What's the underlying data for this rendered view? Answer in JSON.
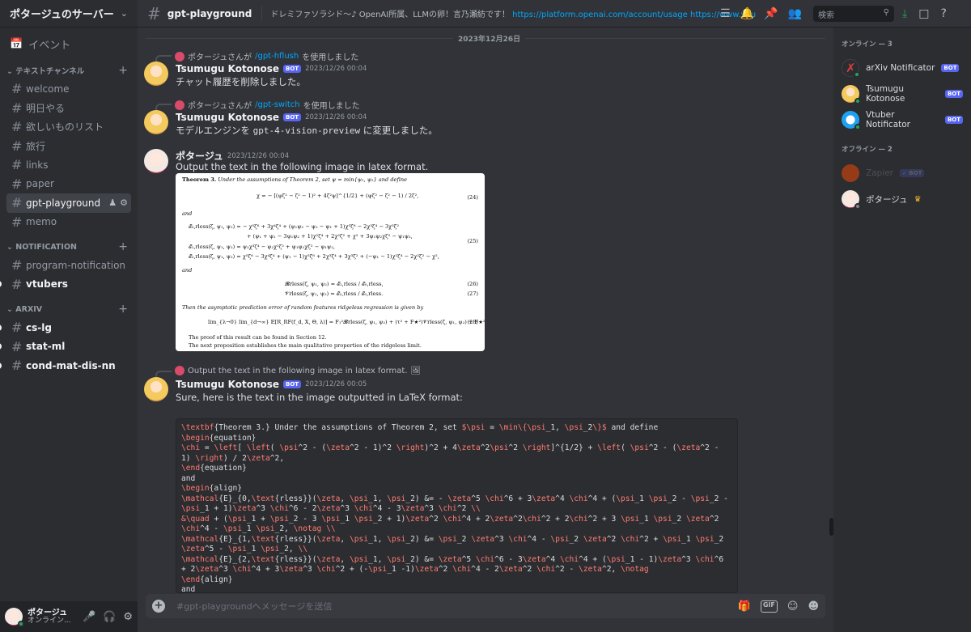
{
  "server": {
    "name": "ポタージュのサーバー"
  },
  "sidebar": {
    "event_label": "イベント",
    "categories": [
      {
        "label": "テキストチャンネル",
        "channels": [
          {
            "label": "welcome"
          },
          {
            "label": "明日やる"
          },
          {
            "label": "欲しいものリスト"
          },
          {
            "label": "旅行"
          },
          {
            "label": "links"
          },
          {
            "label": "paper"
          },
          {
            "label": "gpt-playground"
          },
          {
            "label": "memo"
          }
        ]
      },
      {
        "label": "NOTIFICATION",
        "channels": [
          {
            "label": "program-notification"
          },
          {
            "label": "vtubers"
          }
        ]
      },
      {
        "label": "ARXIV",
        "channels": [
          {
            "label": "cs-lg"
          },
          {
            "label": "stat-ml"
          },
          {
            "label": "cond-mat-dis-nn"
          }
        ]
      }
    ]
  },
  "user_panel": {
    "name": "ポタージュ",
    "status": "オンライン..."
  },
  "topbar": {
    "channel": "gpt-playground",
    "topic_text": "ドレミファソラシド〜♪ OpenAI所属、LLMの卵！言乃瀬紡です！",
    "topic_links": "https://platform.openai.com/account/usage https://www.youtube.com...",
    "search_placeholder": "検索"
  },
  "chat": {
    "date": "2023年12月26日",
    "messages": [
      {
        "ref_user": "ポタージュさんが",
        "ref_cmd": "/gpt-hflush",
        "ref_suffix": "を使用しました",
        "author": "Tsumugu Kotonose",
        "bot": "BOT",
        "timestamp": "2023/12/26 00:04",
        "text": "チャット履歴を削除しました。"
      },
      {
        "ref_user": "ポタージュさんが",
        "ref_cmd": "/gpt-switch",
        "ref_suffix": "を使用しました",
        "author": "Tsumugu Kotonose",
        "bot": "BOT",
        "timestamp": "2023/12/26 00:04",
        "text_pre": "モデルエンジンを ",
        "text_code": "gpt-4-vision-preview",
        "text_post": " に変更しました。"
      },
      {
        "author": "ポタージュ",
        "timestamp": "2023/12/26 00:04",
        "text": "Output the text in the following image in latex format.",
        "attachment": {
          "l1_b": "Theorem 3.",
          "l1": "Under the assumptions of Theorem 2, set ψ = min{ψ₁, ψ₂} and define",
          "eq24": "χ = − [(ψζ² − ζ² − 1)² + 4ζ²ψ]^{1/2} + (ψζ² − ζ² − 1) / 2ζ²,",
          "n24": "(24)",
          "and1": "and",
          "eq25a": "𝓔₀,rless(ζ, ψ₁, ψ₂) = − χ⁵ζ⁶ + 3χ⁴ζ⁴ + (ψ₁ψ₂ − ψ₂ − ψ₁ + 1)χ³ζ⁶ − 2χ³ζ⁴ − 3χ³ζ²",
          "eq25b": "+ (ψ₁ + ψ₂ − 3ψ₁ψ₂ + 1)χ²ζ⁴ + 2χ²ζ² + χ² + 3ψ₁ψ₂χζ² − ψ₁ψ₂,",
          "n25": "(25)",
          "eq25c": "𝓔₁,rless(ζ, ψ₁, ψ₂) = ψ₂χ³ζ⁴ − ψ₂χ²ζ² + ψ₁ψ₂χζ² − ψ₁ψ₂,",
          "eq25d": "𝓔₂,rless(ζ, ψ₁, ψ₂) = χ⁵ζ⁶ − 3χ⁴ζ⁴ + (ψ₁ − 1)χ³ζ⁶ + 2χ³ζ⁴ + 3χ³ζ² + (−ψ₁ − 1)χ²ζ⁴ − 2χ²ζ² − χ²,",
          "and2": "and",
          "eq26": "𝓑rless(ζ, ψ₁, ψ₂) = 𝓔₁,rless / 𝓔₀,rless,",
          "n26": "(26)",
          "eq27": "𝓥rless(ζ, ψ₁, ψ₂) = 𝓔₂,rless / 𝓔₀,rless.",
          "n27": "(27)",
          "then": "Then the asymptotic prediction error of random features ridgeless regression is given by",
          "eq28": "lim_{λ→0} lim_{d→∞} 𝔼[R_RF(f_d, X, Θ, λ)] = F₁²𝓑rless(ζ, ψ₁, ψ₂) + (τ² + F★²)𝓥rless(ζ, ψ₁, ψ₂) + F★².",
          "n28": "(28)",
          "proof": "The proof of this result can be found in Section 12.",
          "next": "The next proposition establishes the main qualitative properties of the ridgeless limit."
        }
      },
      {
        "ref_user": "",
        "ref_cmd": "",
        "ref_suffix": "Output the text in the following image in latex format.",
        "author": "Tsumugu Kotonose",
        "bot": "BOT",
        "timestamp": "2023/12/26 00:05",
        "text": "Sure, here is the text in the image outputted in LaTeX format:",
        "code_lines": [
          [
            "\\textbf",
            "{Theorem 3.} Under the assumptions of Theorem 2, set ",
            "$\\psi",
            " = ",
            "\\min",
            "\\{",
            "\\psi",
            "_1, ",
            "\\psi",
            "_2",
            "\\}",
            "$",
            " and define"
          ],
          [
            "\\begin",
            "{equation}"
          ],
          [
            "\\chi",
            " = ",
            "\\left",
            "[ ",
            "\\left",
            "( ",
            "\\psi",
            "^2 - (",
            "\\zeta",
            "^2 - 1)^2 ",
            "\\right",
            ")^2 + 4",
            "\\zeta",
            "^2",
            "\\psi",
            "^2 ",
            "\\right",
            "]^{1/2} + ",
            "\\left",
            "( ",
            "\\psi",
            "^2 - (",
            "\\zeta",
            "^2 -"
          ],
          [
            "1) ",
            "\\right",
            ") / 2",
            "\\zeta",
            "^2,"
          ],
          [
            "\\end",
            "{equation}"
          ],
          [
            "and"
          ],
          [
            "\\begin",
            "{align}"
          ],
          [
            "\\mathcal",
            "{E}_{0,",
            "\\text",
            "{rless}}(",
            "\\zeta",
            ", ",
            "\\psi",
            "_1, ",
            "\\psi",
            "_2) &= - ",
            "\\zeta",
            "^5 ",
            "\\chi",
            "^6 + 3",
            "\\zeta",
            "^4 ",
            "\\chi",
            "^4 + (",
            "\\psi",
            "_1 ",
            "\\psi",
            "_2 - ",
            "\\psi",
            "_2 -"
          ],
          [
            "\\psi",
            "_1 + 1)",
            "\\zeta",
            "^3 ",
            "\\chi",
            "^6 - 2",
            "\\zeta",
            "^3 ",
            "\\chi",
            "^4 - 3",
            "\\zeta",
            "^3 ",
            "\\chi",
            "^2 ",
            "\\\\"
          ],
          [
            "&",
            "\\quad",
            " + (",
            "\\psi",
            "_1 + ",
            "\\psi",
            "_2 - 3 ",
            "\\psi",
            "_1 ",
            "\\psi",
            "_2 + 1)",
            "\\zeta",
            "^2 ",
            "\\chi",
            "^4 + 2",
            "\\zeta",
            "^2",
            "\\chi",
            "^2 + 2",
            "\\chi",
            "^2 + 3 ",
            "\\psi",
            "_1 ",
            "\\psi",
            "_2 ",
            "\\zeta",
            "^2"
          ],
          [
            "\\chi",
            "^4 - ",
            "\\psi",
            "_1 ",
            "\\psi",
            "_2, ",
            "\\notag",
            " ",
            "\\\\"
          ],
          [
            "\\mathcal",
            "{E}_{1,",
            "\\text",
            "{rless}}(",
            "\\zeta",
            ", ",
            "\\psi",
            "_1, ",
            "\\psi",
            "_2) &= ",
            "\\psi",
            "_2 ",
            "\\zeta",
            "^3 ",
            "\\chi",
            "^4 - ",
            "\\psi",
            "_2 ",
            "\\zeta",
            "^2 ",
            "\\chi",
            "^2 + ",
            "\\psi",
            "_1 ",
            "\\psi",
            "_2"
          ],
          [
            "\\zeta",
            "^5 - ",
            "\\psi",
            "_1 ",
            "\\psi",
            "_2, ",
            "\\\\"
          ],
          [
            "\\mathcal",
            "{E}_{2,",
            "\\text",
            "{rless}}(",
            "\\zeta",
            ", ",
            "\\psi",
            "_1, ",
            "\\psi",
            "_2) &= ",
            "\\zeta",
            "^5 ",
            "\\chi",
            "^6 - 3",
            "\\zeta",
            "^4 ",
            "\\chi",
            "^4 + (",
            "\\psi",
            "_1 - 1)",
            "\\zeta",
            "^3 ",
            "\\chi",
            "^6"
          ],
          [
            "+ 2",
            "\\zeta",
            "^3 ",
            "\\chi",
            "^4 + 3",
            "\\zeta",
            "^3 ",
            "\\chi",
            "^2 + (-",
            "\\psi",
            "_1 -1)",
            "\\zeta",
            "^2 ",
            "\\chi",
            "^4 - 2",
            "\\zeta",
            "^2 ",
            "\\chi",
            "^2 - ",
            "\\zeta",
            "^2, ",
            "\\notag"
          ],
          [
            "\\end",
            "{align}"
          ],
          [
            "and"
          ]
        ]
      }
    ]
  },
  "composer": {
    "placeholder": "#gpt-playgroundへメッセージを送信",
    "gif": "GIF"
  },
  "members": {
    "online_label": "オンライン — 3",
    "offline_label": "オフライン — 2",
    "online": [
      {
        "name": "arXiv Notificator",
        "bot": "BOT"
      },
      {
        "name": "Tsumugu Kotonose",
        "bot": "BOT"
      },
      {
        "name": "Vtuber Notificator",
        "bot": "BOT"
      }
    ],
    "offline": [
      {
        "name": "Zapier",
        "bot": "✓ BOT"
      },
      {
        "name": "ポタージュ"
      }
    ]
  },
  "colors": {
    "accent": "#5865f2",
    "link": "#00a8fc",
    "online": "#23a559",
    "code_keyword": "#ff7b72"
  }
}
